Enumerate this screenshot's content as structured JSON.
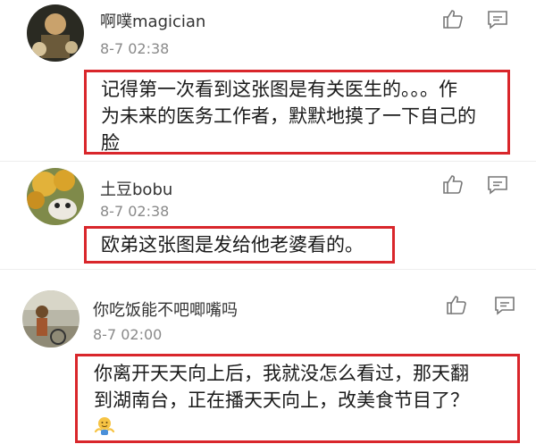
{
  "comments": [
    {
      "username": "啊噗magician",
      "time": "8-7 02:38",
      "lines": [
        "记得第一次看到这张图是有关医生的。。。作",
        "为未来的医务工作者，默默地摸了一下自己的",
        "脸"
      ]
    },
    {
      "username": "土豆bobu",
      "time": "8-7 02:38",
      "lines": [
        "欧弟这张图是发给他老婆看的。"
      ]
    },
    {
      "username": "你吃饭能不吧唧嘴吗",
      "time": "8-7 02:00",
      "lines": [
        "你离开天天向上后，我就没怎么看过，那天翻",
        "到湖南台，正在播天天向上，改美食节目了？"
      ]
    }
  ],
  "icons": {
    "like": "thumbs-up-icon",
    "reply": "comment-bubble-icon"
  },
  "highlight_color": "#d9262b"
}
